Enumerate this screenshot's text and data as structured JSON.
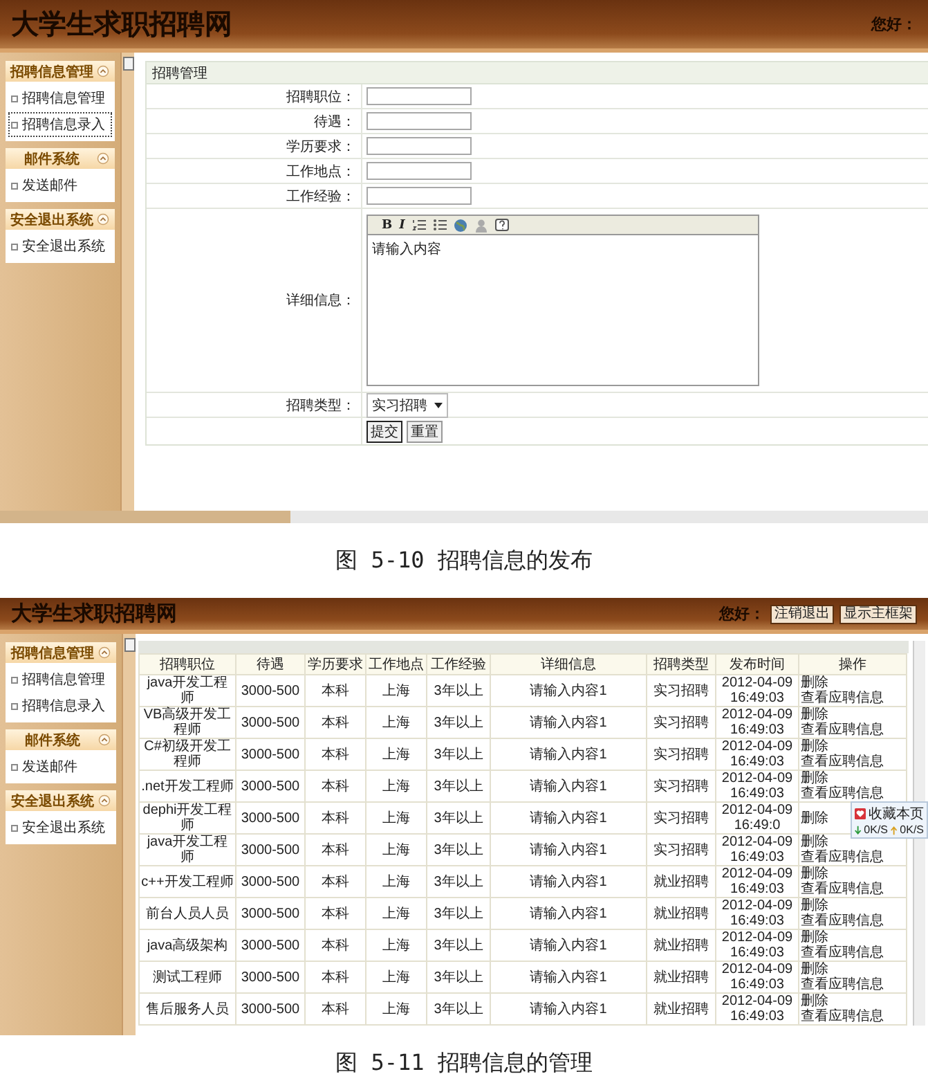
{
  "figures": [
    {
      "kind": "form",
      "screen": {
        "title": "大学生求职招聘网",
        "greeting": "您好：",
        "sidebar": [
          {
            "title": "招聘信息管理",
            "items": [
              {
                "label": "招聘信息管理",
                "selected": false
              },
              {
                "label": "招聘信息录入",
                "selected": true
              }
            ]
          },
          {
            "title": "邮件系统",
            "items": [
              {
                "label": "发送邮件",
                "selected": false
              }
            ]
          },
          {
            "title": "安全退出系统",
            "items": [
              {
                "label": "安全退出系统",
                "selected": false
              }
            ]
          }
        ],
        "panel_title": "招聘管理",
        "fields": [
          {
            "kind": "text",
            "label": "招聘职位："
          },
          {
            "kind": "text",
            "label": "待遇："
          },
          {
            "kind": "text",
            "label": "学历要求："
          },
          {
            "kind": "text",
            "label": "工作地点："
          },
          {
            "kind": "text",
            "label": "工作经验："
          },
          {
            "kind": "editor",
            "label": "详细信息：",
            "toolbar": [
              "B",
              "I"
            ],
            "value": "请输入内容"
          },
          {
            "kind": "select",
            "label": "招聘类型：",
            "value": "实习招聘"
          },
          {
            "kind": "buttons",
            "buttons": [
              "提交",
              "重置"
            ]
          }
        ]
      },
      "caption": "图 5-10 招聘信息的发布"
    },
    {
      "kind": "table",
      "screen": {
        "title": "大学生求职招聘网",
        "greeting": "您好：",
        "header_buttons": [
          "注销退出",
          "显示主框架"
        ],
        "sidebar": [
          {
            "title": "招聘信息管理",
            "items": [
              {
                "label": "招聘信息管理",
                "selected": false
              },
              {
                "label": "招聘信息录入",
                "selected": false
              }
            ]
          },
          {
            "title": "邮件系统",
            "items": [
              {
                "label": "发送邮件",
                "selected": false
              }
            ]
          },
          {
            "title": "安全退出系统",
            "items": [
              {
                "label": "安全退出系统",
                "selected": false
              }
            ]
          }
        ],
        "table": {
          "columns": [
            "招聘职位",
            "待遇",
            "学历要求",
            "工作地点",
            "工作经验",
            "详细信息",
            "招聘类型",
            "发布时间",
            "操作"
          ],
          "rows": [
            {
              "cells": [
                "java开发工程师",
                "3000-500",
                "本科",
                "上海",
                "3年以上",
                "请输入内容1",
                "实习招聘",
                "2012-04-09 16:49:03"
              ],
              "actions": [
                "删除",
                "查看应聘信息"
              ]
            },
            {
              "cells": [
                "VB高级开发工程师",
                "3000-500",
                "本科",
                "上海",
                "3年以上",
                "请输入内容1",
                "实习招聘",
                "2012-04-09 16:49:03"
              ],
              "actions": [
                "删除",
                "查看应聘信息"
              ]
            },
            {
              "cells": [
                "C#初级开发工程师",
                "3000-500",
                "本科",
                "上海",
                "3年以上",
                "请输入内容1",
                "实习招聘",
                "2012-04-09 16:49:03"
              ],
              "actions": [
                "删除",
                "查看应聘信息"
              ]
            },
            {
              "cells": [
                ".net开发工程师",
                "3000-500",
                "本科",
                "上海",
                "3年以上",
                "请输入内容1",
                "实习招聘",
                "2012-04-09 16:49:03"
              ],
              "actions": [
                "删除",
                "查看应聘信息"
              ]
            },
            {
              "cells": [
                "dephi开发工程师",
                "3000-500",
                "本科",
                "上海",
                "3年以上",
                "请输入内容1",
                "实习招聘",
                "2012-04-09 16:49:0"
              ],
              "actions": [
                "删除"
              ]
            },
            {
              "cells": [
                "java开发工程师",
                "3000-500",
                "本科",
                "上海",
                "3年以上",
                "请输入内容1",
                "实习招聘",
                "2012-04-09 16:49:03"
              ],
              "actions": [
                "删除",
                "查看应聘信息"
              ]
            },
            {
              "cells": [
                "c++开发工程师",
                "3000-500",
                "本科",
                "上海",
                "3年以上",
                "请输入内容1",
                "就业招聘",
                "2012-04-09 16:49:03"
              ],
              "actions": [
                "删除",
                "查看应聘信息"
              ]
            },
            {
              "cells": [
                "前台人员人员",
                "3000-500",
                "本科",
                "上海",
                "3年以上",
                "请输入内容1",
                "就业招聘",
                "2012-04-09 16:49:03"
              ],
              "actions": [
                "删除",
                "查看应聘信息"
              ]
            },
            {
              "cells": [
                "java高级架构",
                "3000-500",
                "本科",
                "上海",
                "3年以上",
                "请输入内容1",
                "就业招聘",
                "2012-04-09 16:49:03"
              ],
              "actions": [
                "删除",
                "查看应聘信息"
              ]
            },
            {
              "cells": [
                "测试工程师",
                "3000-500",
                "本科",
                "上海",
                "3年以上",
                "请输入内容1",
                "就业招聘",
                "2012-04-09 16:49:03"
              ],
              "actions": [
                "删除",
                "查看应聘信息"
              ]
            },
            {
              "cells": [
                "售后服务人员",
                "3000-500",
                "本科",
                "上海",
                "3年以上",
                "请输入内容1",
                "就业招聘",
                "2012-04-09 16:49:03"
              ],
              "actions": [
                "删除",
                "查看应聘信息"
              ]
            }
          ]
        },
        "overlay": {
          "label": "收藏本页",
          "download": "0K/S",
          "upload": "0K/S"
        }
      },
      "caption": "图 5-11 招聘信息的管理"
    }
  ]
}
